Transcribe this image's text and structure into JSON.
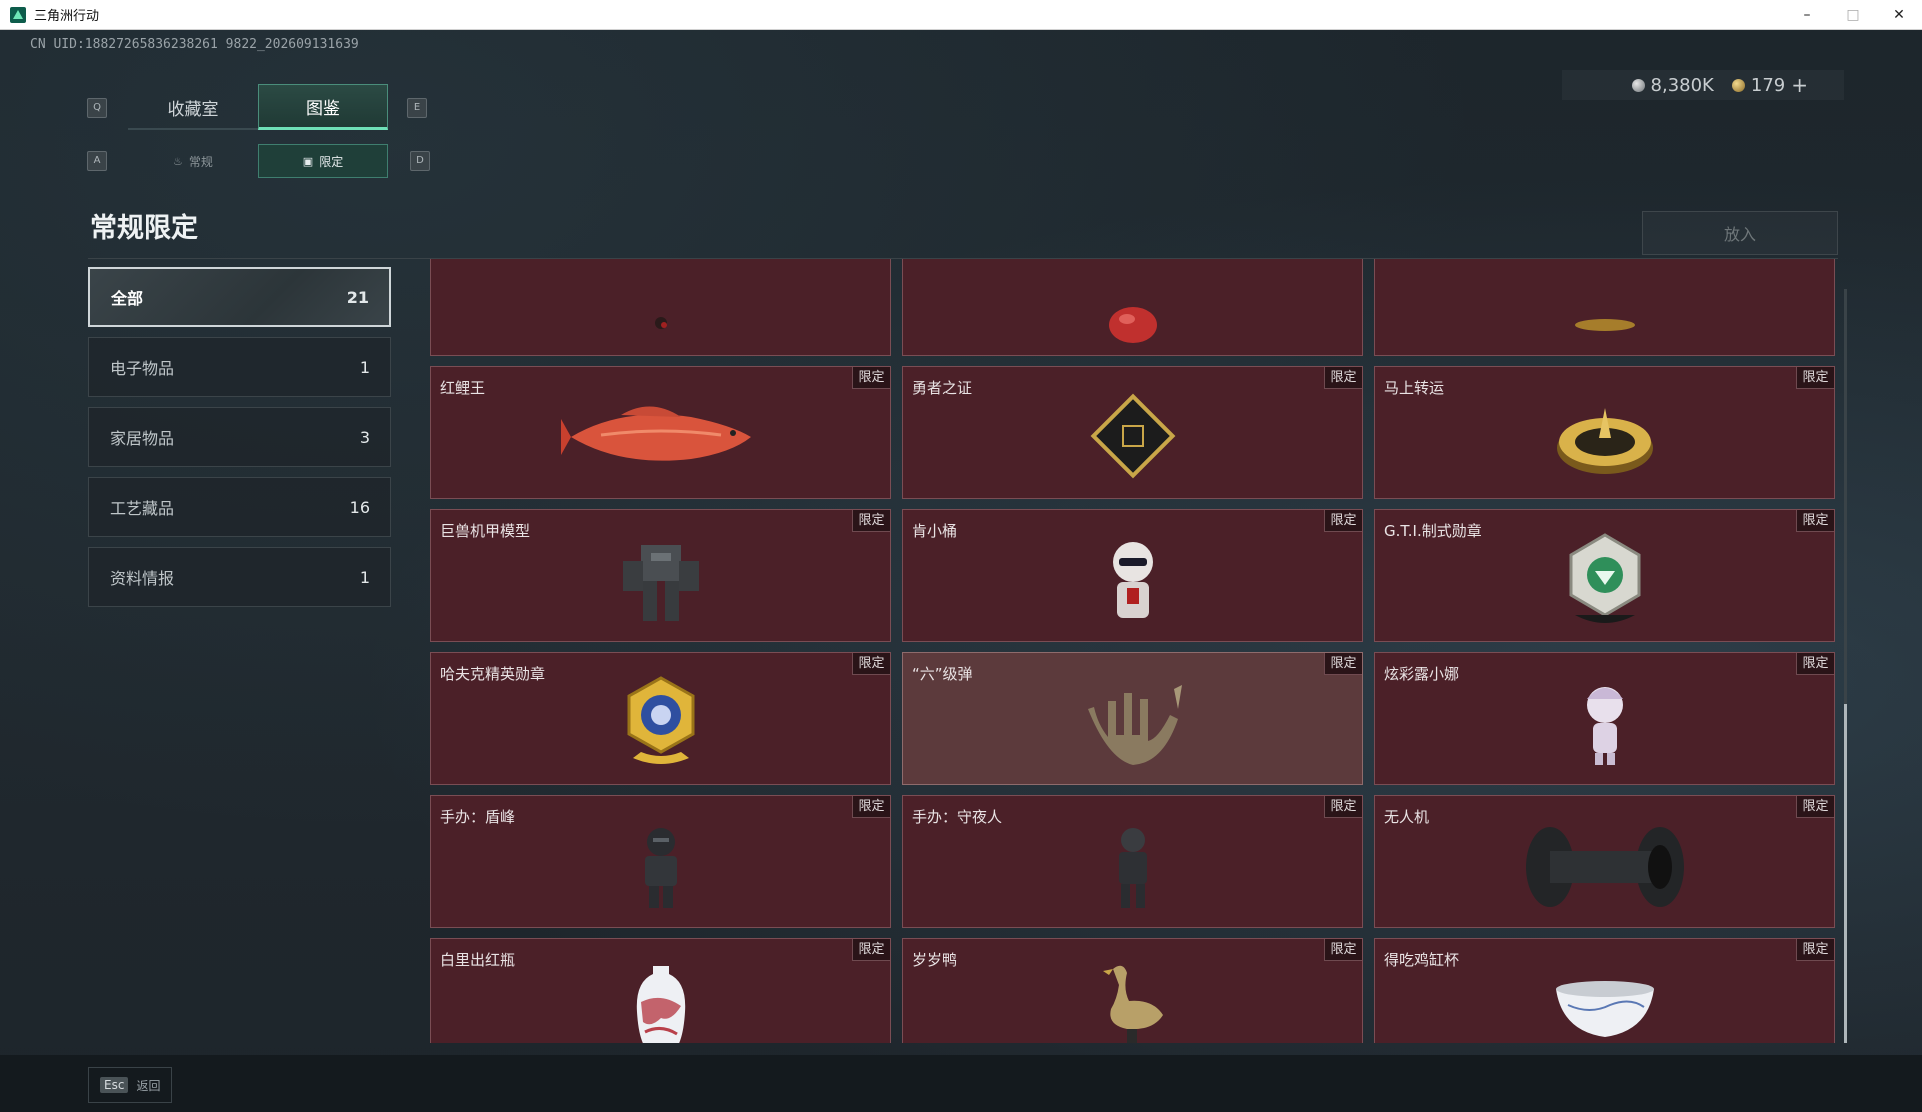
{
  "window": {
    "title": "三角洲行动",
    "minimize": "–",
    "maximize": "□",
    "close": "✕"
  },
  "uid": "CN UID:18827265836238261 9822_202609131639",
  "currency": {
    "silver": "8,380K",
    "gold": "179",
    "plus": "+"
  },
  "keys": {
    "prev_tab": "Q",
    "next_tab": "E",
    "prev_sub": "A",
    "next_sub": "D"
  },
  "tabs": [
    {
      "label": "收藏室"
    },
    {
      "label": "图鉴"
    }
  ],
  "subtabs": [
    {
      "label": "常规",
      "icon": "flame-icon"
    },
    {
      "label": "限定",
      "icon": "picture-icon"
    }
  ],
  "page_title": "常规限定",
  "place_button": "放入",
  "categories": [
    {
      "label": "全部",
      "count": "21"
    },
    {
      "label": "电子物品",
      "count": "1"
    },
    {
      "label": "家居物品",
      "count": "3"
    },
    {
      "label": "工艺藏品",
      "count": "16"
    },
    {
      "label": "资料情报",
      "count": "1"
    }
  ],
  "badge": "限定",
  "items": [
    {
      "name": "",
      "icon": "figure-icon"
    },
    {
      "name": "",
      "icon": "apple-icon"
    },
    {
      "name": "",
      "icon": "gold-ornament-icon"
    },
    {
      "name": "红鲤王",
      "icon": "carp-fish-icon"
    },
    {
      "name": "勇者之证",
      "icon": "gold-card-icon"
    },
    {
      "name": "马上转运",
      "icon": "gold-disc-icon"
    },
    {
      "name": "巨兽机甲模型",
      "icon": "mech-model-icon"
    },
    {
      "name": "肯小桶",
      "icon": "colonel-figure-icon"
    },
    {
      "name": "G.T.I.制式勋章",
      "icon": "gti-medal-icon"
    },
    {
      "name": "哈夫克精英勋章",
      "icon": "elite-medal-icon"
    },
    {
      "name": "“六”级弹",
      "icon": "bullet-hand-icon"
    },
    {
      "name": "炫彩露小娜",
      "icon": "girl-figure-icon"
    },
    {
      "name": "手办：盾峰",
      "icon": "armored-figure-icon"
    },
    {
      "name": "手办：守夜人",
      "icon": "nightwatch-figure-icon"
    },
    {
      "name": "无人机",
      "icon": "drone-icon"
    },
    {
      "name": "白里出红瓶",
      "icon": "porcelain-vase-icon"
    },
    {
      "name": "岁岁鸭",
      "icon": "duck-statue-icon"
    },
    {
      "name": "得吃鸡缸杯",
      "icon": "porcelain-cup-icon"
    }
  ],
  "bottom": {
    "esc_key": "Esc",
    "esc_label": "返回"
  }
}
